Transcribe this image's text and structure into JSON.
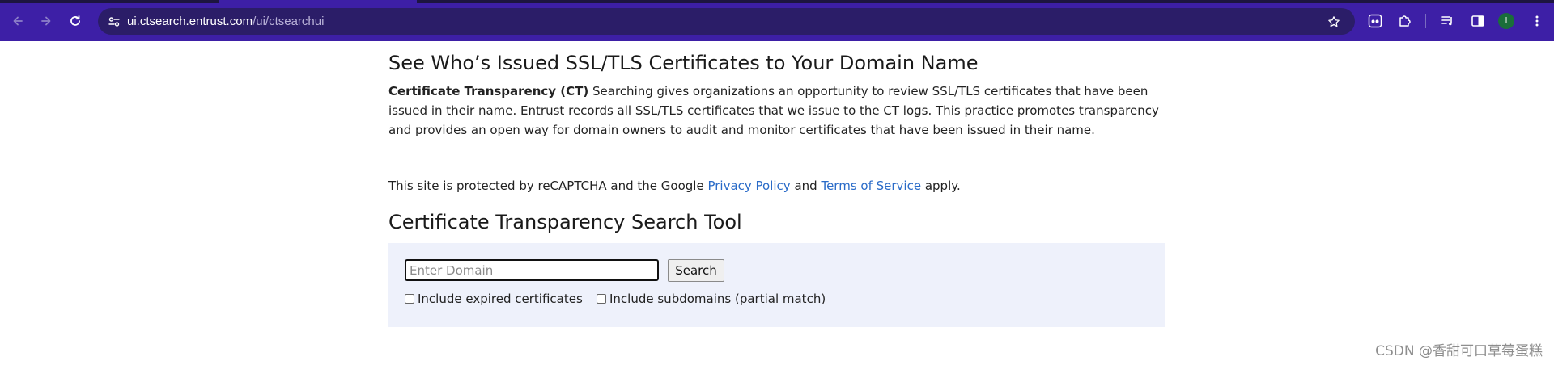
{
  "browser": {
    "url_host": "ui.ctsearch.entrust.com",
    "url_path": "/ui/ctsearchui",
    "profile_initial": "I",
    "colors": {
      "frame": "#3d1fa6",
      "omnibox": "#2b1d68",
      "avatar": "#1a6e3a"
    },
    "icons": [
      "back-arrow-icon",
      "forward-arrow-icon",
      "reload-icon",
      "site-info-icon",
      "bookmark-star-icon",
      "extension-ghost-icon",
      "extensions-puzzle-icon",
      "media-controls-icon",
      "side-panel-icon",
      "menu-dots-icon"
    ]
  },
  "page": {
    "heading": "See Who’s Issued SSL/TLS Certificates to Your Domain Name",
    "intro_bold": "Certificate Transparency (CT)",
    "intro_text": " Searching gives organizations an opportunity to review SSL/TLS certificates that have been issued in their name. Entrust records all SSL/TLS certificates that we issue to the CT logs. This practice promotes transparency and provides an open way for domain owners to audit and monitor certificates that have been issued in their name.",
    "captcha_prefix": "This site is protected by reCAPTCHA and the Google ",
    "privacy_link": "Privacy Policy",
    "captcha_and": " and ",
    "terms_link": "Terms of Service",
    "captcha_suffix": " apply.",
    "tool_heading": "Certificate Transparency Search Tool",
    "search": {
      "placeholder": "Enter Domain",
      "value": "",
      "button_label": "Search",
      "include_expired_label": "Include expired certificates",
      "include_expired_checked": false,
      "include_subdomains_label": "Include subdomains (partial match)",
      "include_subdomains_checked": false
    },
    "link_color": "#2a6bc8",
    "panel_color": "#eef1fb"
  },
  "watermark": "CSDN @香甜可口草莓蛋糕"
}
